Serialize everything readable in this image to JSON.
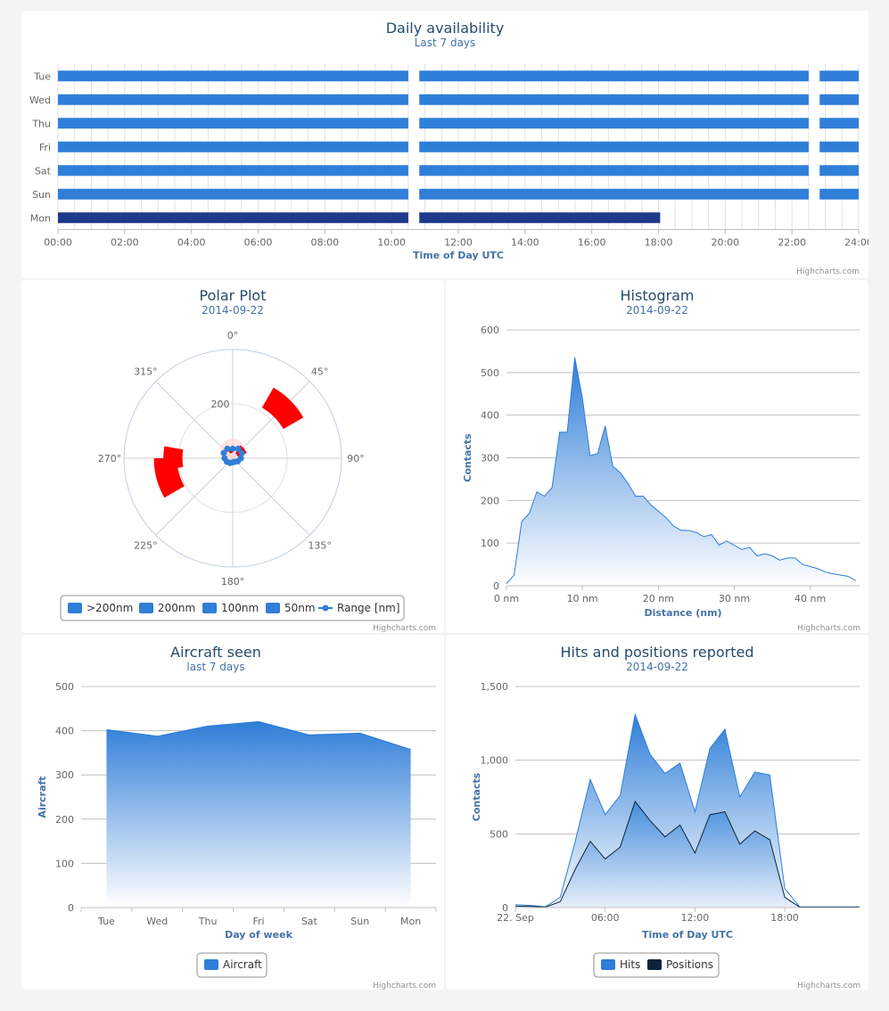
{
  "colors": {
    "bar": "#2f7ed8",
    "bar_today": "#1f3a8a",
    "title": "#274b6d",
    "subtitle": "#4572a7",
    "label": "#666666",
    "grid": "#c0c0c0",
    "red": "#ff0000",
    "positions": "#0d233a"
  },
  "credits": "Highcharts.com",
  "chart_data": [
    {
      "id": "availability",
      "type": "bar",
      "title": "Daily availability",
      "subtitle": "Last 7 days",
      "xlabel": "Time of Day UTC",
      "categories": [
        "Tue",
        "Wed",
        "Thu",
        "Fri",
        "Sat",
        "Sun",
        "Mon"
      ],
      "x_ticks": [
        "00:00",
        "02:00",
        "04:00",
        "06:00",
        "08:00",
        "10:00",
        "12:00",
        "14:00",
        "16:00",
        "18:00",
        "20:00",
        "22:00",
        "24:00"
      ],
      "xlim": [
        0,
        24
      ],
      "intervals": [
        [
          [
            0,
            10.5
          ],
          [
            10.83,
            22.5
          ],
          [
            22.83,
            24
          ]
        ],
        [
          [
            0,
            10.5
          ],
          [
            10.83,
            22.5
          ],
          [
            22.83,
            24
          ]
        ],
        [
          [
            0,
            10.5
          ],
          [
            10.83,
            22.5
          ],
          [
            22.83,
            24
          ]
        ],
        [
          [
            0,
            10.5
          ],
          [
            10.83,
            22.5
          ],
          [
            22.83,
            24
          ]
        ],
        [
          [
            0,
            10.5
          ],
          [
            10.83,
            22.5
          ],
          [
            22.83,
            24
          ]
        ],
        [
          [
            0,
            10.5
          ],
          [
            10.83,
            22.5
          ],
          [
            22.83,
            24
          ]
        ],
        [
          [
            0,
            10.5
          ],
          [
            10.83,
            18.05
          ]
        ]
      ]
    },
    {
      "id": "polar",
      "type": "polar",
      "title": "Polar Plot",
      "subtitle": "2014-09-22",
      "angle_ticks": [
        "0°",
        "45°",
        "90°",
        "135°",
        "180°",
        "225°",
        "270°",
        "315°"
      ],
      "radial_label": "200",
      "rmax": 400,
      "series": [
        {
          "name": ">200nm",
          "segments": [
            [
              30,
              60,
              215,
              300
            ],
            [
              240,
              270,
              205,
              290
            ],
            [
              260,
              280,
              185,
              255
            ]
          ]
        },
        {
          "name": "200nm",
          "segments": []
        },
        {
          "name": "100nm",
          "segments": []
        },
        {
          "name": "50nm",
          "segments": [
            [
              30,
              70,
              20,
              55
            ],
            [
              330,
              360,
              20,
              35
            ]
          ]
        },
        {
          "name": "Range [nm]",
          "points": [
            [
              0,
              35
            ],
            [
              30,
              40
            ],
            [
              60,
              38
            ],
            [
              90,
              30
            ],
            [
              120,
              22
            ],
            [
              150,
              15
            ],
            [
              180,
              15
            ],
            [
              210,
              20
            ],
            [
              240,
              25
            ],
            [
              270,
              30
            ],
            [
              300,
              38
            ],
            [
              330,
              40
            ]
          ]
        }
      ]
    },
    {
      "id": "histogram",
      "type": "area",
      "title": "Histogram",
      "subtitle": "2014-09-22",
      "xlabel": "Distance (nm)",
      "ylabel": "Contacts",
      "ylim": [
        0,
        600
      ],
      "y_ticks": [
        "0",
        "100",
        "200",
        "300",
        "400",
        "500",
        "600"
      ],
      "x_ticks": [
        "0 nm",
        "10 nm",
        "20 nm",
        "30 nm",
        "40 nm"
      ],
      "xlim": [
        0,
        46.5
      ],
      "x": [
        0,
        1,
        2,
        3,
        4,
        5,
        6,
        7,
        8,
        9,
        10,
        11,
        12,
        13,
        14,
        15,
        16,
        17,
        18,
        19,
        20,
        21,
        22,
        23,
        24,
        25,
        26,
        27,
        28,
        29,
        30,
        31,
        32,
        33,
        34,
        35,
        36,
        37,
        38,
        39,
        40,
        41,
        42,
        43,
        44,
        45,
        46
      ],
      "values": [
        5,
        25,
        150,
        170,
        220,
        210,
        230,
        360,
        360,
        535,
        440,
        305,
        310,
        375,
        280,
        265,
        240,
        210,
        210,
        190,
        175,
        160,
        140,
        130,
        130,
        125,
        115,
        120,
        95,
        105,
        95,
        85,
        90,
        70,
        75,
        70,
        60,
        65,
        65,
        50,
        45,
        40,
        32,
        28,
        25,
        22,
        12
      ]
    },
    {
      "id": "aircraft",
      "type": "area",
      "title": "Aircraft seen",
      "subtitle": "last 7 days",
      "xlabel": "Day of week",
      "ylabel": "Aircraft",
      "ylim": [
        0,
        500
      ],
      "y_ticks": [
        "0",
        "100",
        "200",
        "300",
        "400",
        "500"
      ],
      "categories": [
        "Tue",
        "Wed",
        "Thu",
        "Fri",
        "Sat",
        "Sun",
        "Mon"
      ],
      "series": [
        {
          "name": "Aircraft",
          "values": [
            402,
            387,
            410,
            420,
            390,
            394,
            357
          ]
        }
      ]
    },
    {
      "id": "hits",
      "type": "area",
      "title": "Hits and positions reported",
      "subtitle": "2014-09-22",
      "xlabel": "Time of Day UTC",
      "ylabel": "Contacts",
      "ylim": [
        0,
        1500
      ],
      "y_ticks": [
        "0",
        "500",
        "1,000",
        "1,500"
      ],
      "x_ticks": [
        {
          "label": "22. Sep",
          "x": 0
        },
        {
          "label": "06:00",
          "x": 6
        },
        {
          "label": "12:00",
          "x": 12
        },
        {
          "label": "18:00",
          "x": 18
        }
      ],
      "xlim": [
        0,
        23
      ],
      "x": [
        0,
        1,
        2,
        3,
        4,
        5,
        6,
        7,
        8,
        9,
        10,
        11,
        12,
        13,
        14,
        15,
        16,
        17,
        18,
        19,
        20,
        21,
        22,
        23
      ],
      "series": [
        {
          "name": "Hits",
          "values": [
            20,
            15,
            5,
            70,
            450,
            870,
            630,
            760,
            1310,
            1040,
            910,
            980,
            650,
            1080,
            1210,
            750,
            920,
            900,
            130,
            5,
            5,
            5,
            5,
            5
          ]
        },
        {
          "name": "Positions",
          "values": [
            10,
            8,
            3,
            40,
            260,
            450,
            330,
            410,
            720,
            590,
            480,
            560,
            370,
            630,
            650,
            430,
            520,
            460,
            70,
            3,
            3,
            3,
            3,
            3
          ]
        }
      ]
    }
  ]
}
